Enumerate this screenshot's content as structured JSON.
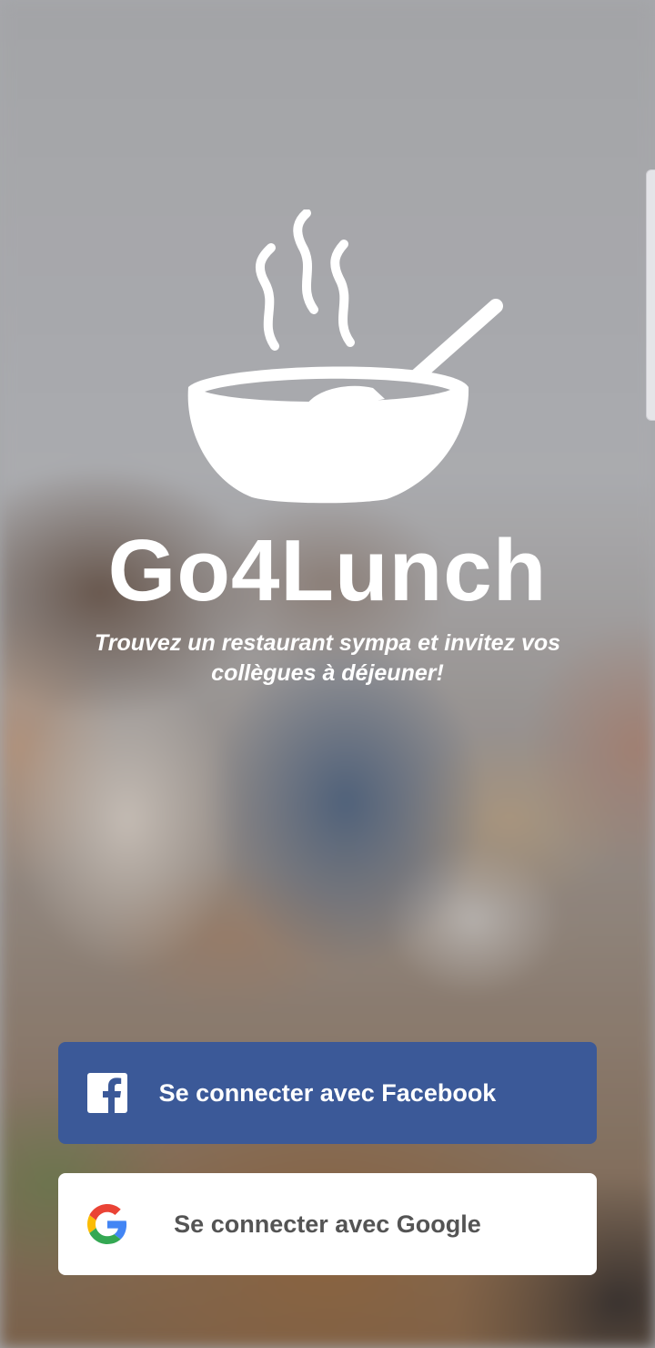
{
  "app": {
    "title": "Go4Lunch",
    "tagline": "Trouvez un restaurant sympa et invitez vos collègues à déjeuner!",
    "logo_icon": "soup-bowl-icon"
  },
  "auth": {
    "facebook": {
      "label": "Se connecter avec Facebook",
      "icon": "facebook-icon",
      "color": "#3b5998"
    },
    "google": {
      "label": "Se connecter avec Google",
      "icon": "google-icon",
      "color": "#ffffff"
    }
  }
}
